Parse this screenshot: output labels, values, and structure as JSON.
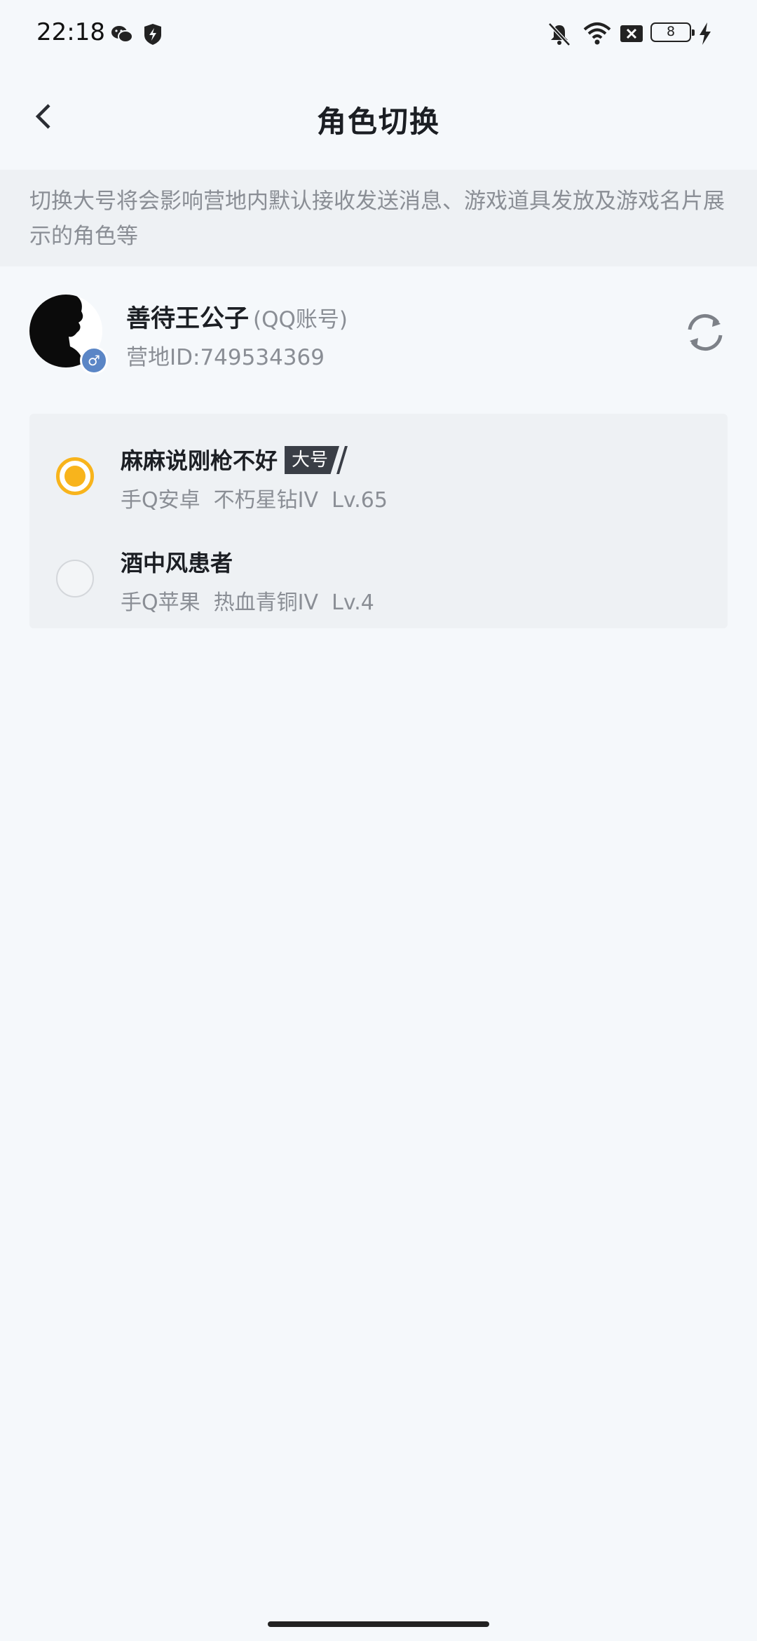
{
  "status_bar": {
    "time": "22:18",
    "battery_level": "8",
    "icons": [
      "wechat-icon",
      "shield-icon",
      "mute-icon",
      "wifi-icon",
      "sim-x-icon",
      "battery-icon",
      "charging-icon"
    ]
  },
  "header": {
    "title": "角色切换",
    "back_icon": "chevron-left-icon"
  },
  "notice": {
    "text": "切换大号将会影响营地内默认接收发送消息、游戏道具发放及游戏名片展示的角色等"
  },
  "account": {
    "name": "善待王公子",
    "type": "(QQ账号)",
    "camp_id": "营地ID:749534369",
    "gender": "♂",
    "refresh_icon": "refresh-icon"
  },
  "roles": [
    {
      "name": "麻麻说刚枪不好",
      "tag": "大号",
      "meta": "手Q安卓  不朽星钻IV  Lv.65",
      "selected": true
    },
    {
      "name": "酒中风患者",
      "tag": "",
      "meta": "手Q苹果  热血青铜IV  Lv.4",
      "selected": false
    }
  ],
  "colors": {
    "accent": "#f8b41c",
    "background": "#f5f8fb",
    "card": "#eef1f4",
    "secondary_text": "#8a8e95",
    "tag_bg": "#3a3e46"
  }
}
